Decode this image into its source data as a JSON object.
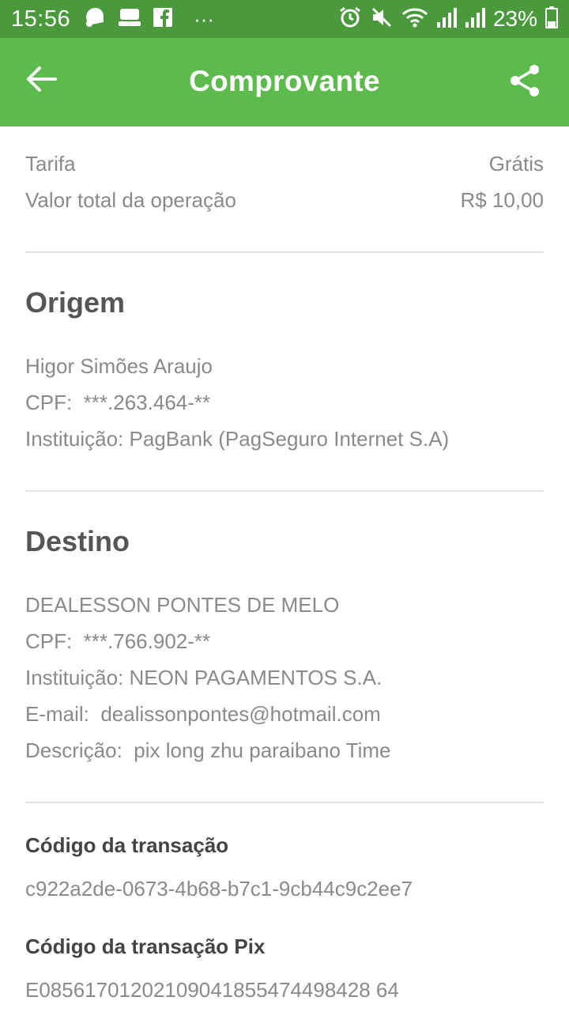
{
  "status_bar": {
    "time": "15:56",
    "battery_percent": "23%",
    "left_icons": [
      "notification-icon",
      "app-icon",
      "facebook-icon",
      "more-dots-icon"
    ],
    "right_icons": [
      "alarm-icon",
      "mute-icon",
      "wifi-icon",
      "signal-icon",
      "signal-icon",
      "battery-icon"
    ],
    "more_dots": "···"
  },
  "app_bar": {
    "title": "Comprovante",
    "color": "#5dbb4e"
  },
  "summary": {
    "tarifa_label": "Tarifa",
    "tarifa_value": "Grátis",
    "total_label": "Valor total da operação",
    "total_value": "R$ 10,00"
  },
  "origem": {
    "title": "Origem",
    "name": "Higor Simões Araujo",
    "cpf": "CPF:  ***.263.464-**",
    "instituicao": "Instituição: PagBank (PagSeguro Internet S.A)"
  },
  "destino": {
    "title": "Destino",
    "name": "DEALESSON PONTES DE MELO",
    "cpf": "CPF:  ***.766.902-**",
    "instituicao": "Instituição: NEON PAGAMENTOS S.A.",
    "email": "E-mail:  dealissonpontes@hotmail.com",
    "descricao": "Descrição:  pix long zhu paraibano Time"
  },
  "transacao": {
    "codigo_label": "Código da transação",
    "codigo_value": "c922a2de-0673-4b68-b7c1-9cb44c9c2ee7",
    "pix_label": "Código da transação Pix",
    "pix_value": "E08561701202109041855474498428 64"
  }
}
